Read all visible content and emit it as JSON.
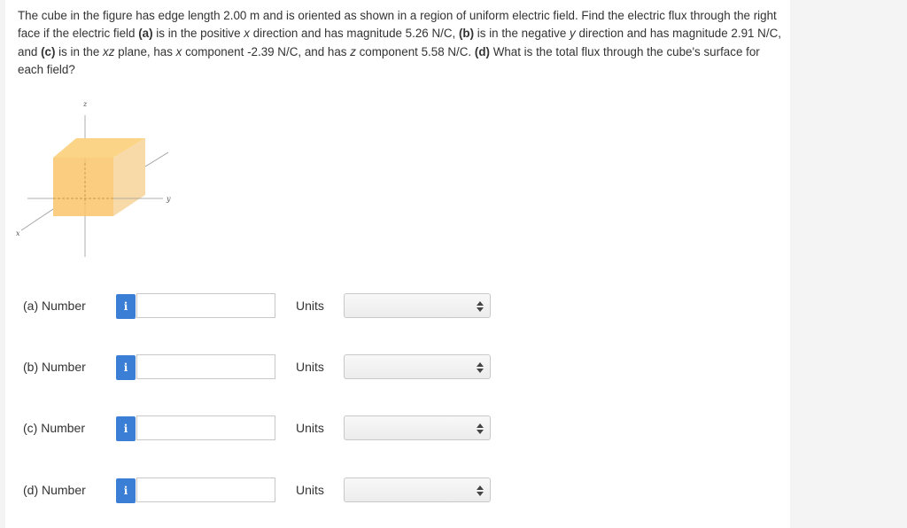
{
  "question": {
    "s1": "The cube in the figure has edge length 2.00 m and is oriented as shown in a region of uniform electric field. Find the electric flux through the right face if the electric field ",
    "a_tag": "(a)",
    "s2": " is in the positive ",
    "x1": "x",
    "s3": " direction and has magnitude 5.26 N/C, ",
    "b_tag": "(b)",
    "s4": " is in the negative ",
    "y1": "y",
    "s5": " direction and has magnitude 2.91 N/C, and ",
    "c_tag": "(c)",
    "s6": " is in the ",
    "xz": "xz",
    "s7": " plane, has ",
    "x2": "x",
    "s8": " component -2.39 N/C, and has ",
    "z1": "z",
    "s9": " component 5.58 N/C. ",
    "d_tag": "(d)",
    "s10": " What is the total flux through the cube's surface for each field?"
  },
  "figure": {
    "axis_z": "z",
    "axis_y": "y",
    "axis_x": "x",
    "cube_color": "#f9c46b",
    "cube_top_color": "#fbd488",
    "cube_side_color": "#f7d49a"
  },
  "answers": [
    {
      "part": "(a)  Number",
      "info": "i",
      "value": "",
      "units_label": "Units",
      "units_value": ""
    },
    {
      "part": "(b)  Number",
      "info": "i",
      "value": "",
      "units_label": "Units",
      "units_value": ""
    },
    {
      "part": "(c)  Number",
      "info": "i",
      "value": "",
      "units_label": "Units",
      "units_value": ""
    },
    {
      "part": "(d)  Number",
      "info": "i",
      "value": "",
      "units_label": "Units",
      "units_value": ""
    }
  ],
  "colors": {
    "info_button": "#3a7fd5",
    "input_border": "#c8c8c8"
  }
}
